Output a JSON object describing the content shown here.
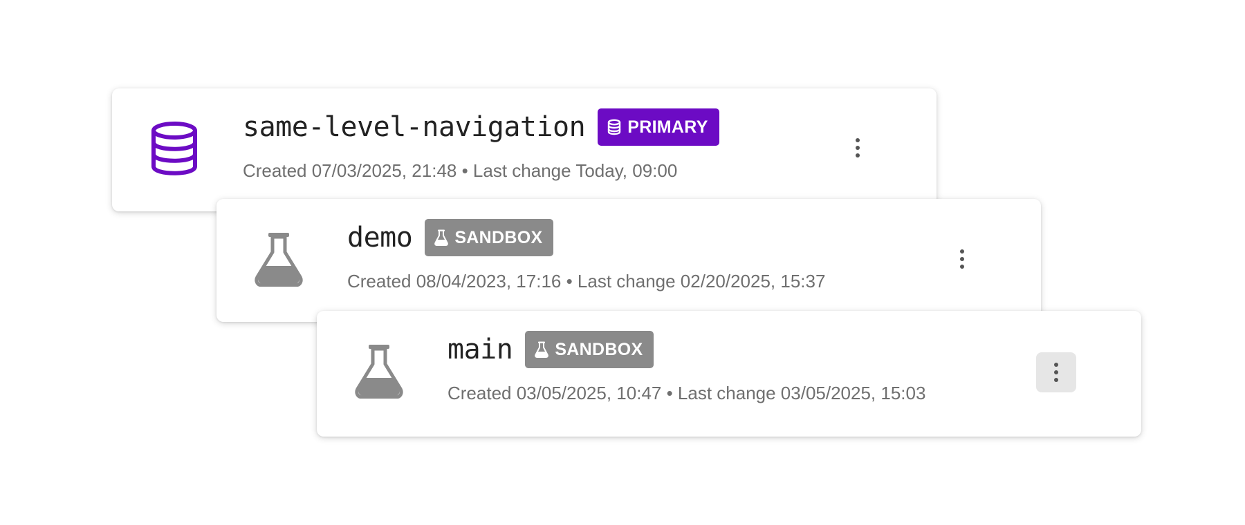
{
  "branches": [
    {
      "name": "same-level-navigation",
      "icon": "database-icon",
      "badge": {
        "label": "PRIMARY",
        "icon": "database-icon",
        "color": "#6c0bc4"
      },
      "meta": "Created 07/03/2025, 21:48 • Last change Today, 09:00",
      "menu_icon": "kebab-menu-icon"
    },
    {
      "name": "demo",
      "icon": "flask-icon",
      "badge": {
        "label": "SANDBOX",
        "icon": "flask-icon",
        "color": "#8a8a8a"
      },
      "meta": "Created 08/04/2023, 17:16 • Last change 02/20/2025, 15:37",
      "menu_icon": "kebab-menu-icon"
    },
    {
      "name": "main",
      "icon": "flask-icon",
      "badge": {
        "label": "SANDBOX",
        "icon": "flask-icon",
        "color": "#8a8a8a"
      },
      "meta": "Created 03/05/2025, 10:47 • Last change 03/05/2025, 15:03",
      "menu_icon": "kebab-menu-icon",
      "menu_hovered": true
    }
  ],
  "colors": {
    "primary_accent": "#6c0bc4",
    "sandbox_gray": "#8a8a8a",
    "text_dark": "#222222",
    "text_muted": "#6f6f6f"
  }
}
